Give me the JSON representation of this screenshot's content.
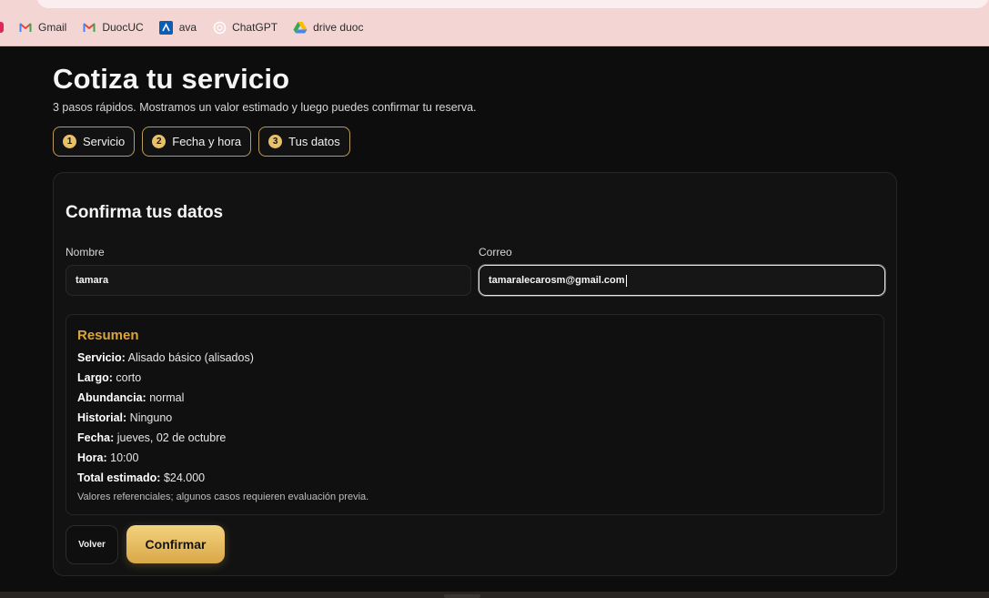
{
  "bookmarks": [
    {
      "label": "Gmail",
      "icon": "gmail-icon"
    },
    {
      "label": "DuocUC",
      "icon": "gmail-icon"
    },
    {
      "label": "ava",
      "icon": "ava-icon"
    },
    {
      "label": "ChatGPT",
      "icon": "chatgpt-icon"
    },
    {
      "label": "drive duoc",
      "icon": "google-drive-icon"
    }
  ],
  "page": {
    "title": "Cotiza tu servicio",
    "subtitle": "3 pasos rápidos. Mostramos un valor estimado y luego puedes confirmar tu reserva."
  },
  "steps": [
    {
      "number": "1",
      "label": "Servicio"
    },
    {
      "number": "2",
      "label": "Fecha y hora"
    },
    {
      "number": "3",
      "label": "Tus datos"
    }
  ],
  "form": {
    "title": "Confirma tus datos",
    "name_label": "Nombre",
    "name_value": "tamara",
    "email_label": "Correo",
    "email_value": "tamaralecarosm@gmail.com"
  },
  "summary": {
    "title": "Resumen",
    "rows": [
      {
        "key": "Servicio:",
        "value": "Alisado básico (alisados)"
      },
      {
        "key": "Largo:",
        "value": "corto"
      },
      {
        "key": "Abundancia:",
        "value": "normal"
      },
      {
        "key": "Historial:",
        "value": "Ninguno"
      },
      {
        "key": "Fecha:",
        "value": "jueves, 02 de octubre"
      },
      {
        "key": "Hora:",
        "value": "10:00"
      },
      {
        "key": "Total estimado:",
        "value": "$24.000"
      }
    ],
    "note": "Valores referenciales; algunos casos requieren evaluación previa."
  },
  "actions": {
    "back_label": "Volver",
    "confirm_label": "Confirmar"
  },
  "colors": {
    "accent_gold": "#e8c067",
    "summary_title": "#d9a63a",
    "background": "#0d0d0d",
    "bookmarks_bar": "#f3d6d3"
  }
}
